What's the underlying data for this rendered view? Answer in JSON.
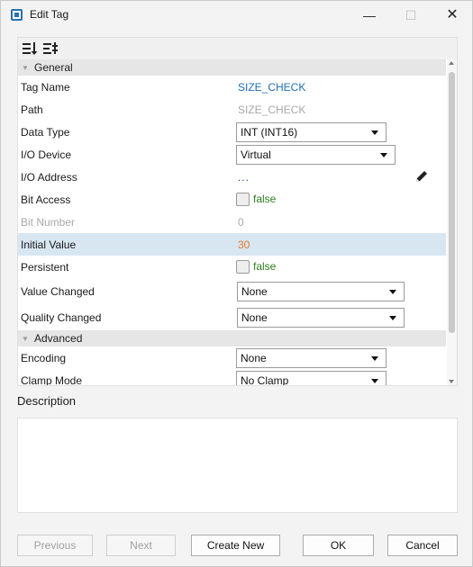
{
  "window": {
    "title": "Edit Tag",
    "controls": {
      "minimize": "—",
      "maximize": "☐",
      "close": "✕"
    },
    "icon": "app-tag-icon"
  },
  "toolbar": {
    "sort_category_icon": "sort-categorized-icon",
    "sort_alpha_icon": "sort-alphabetical-icon"
  },
  "properties": {
    "general": {
      "label": "General",
      "rows": {
        "tag_name": {
          "name": "Tag Name",
          "value": "SIZE_CHECK"
        },
        "path": {
          "name": "Path",
          "value": "SIZE_CHECK"
        },
        "data_type": {
          "name": "Data Type",
          "value": "INT (INT16)"
        },
        "io_device": {
          "name": "I/O Device",
          "value": "Virtual"
        },
        "io_address": {
          "name": "I/O Address",
          "value": "...",
          "icon": "pencil-icon"
        },
        "bit_access": {
          "name": "Bit Access",
          "value": "false",
          "checked": false
        },
        "bit_number": {
          "name": "Bit Number",
          "value": "0"
        },
        "initial_value": {
          "name": "Initial Value",
          "value": "30"
        },
        "persistent": {
          "name": "Persistent",
          "value": "false",
          "checked": false
        },
        "value_changed": {
          "name": "Value Changed",
          "value": "None"
        },
        "quality_changed": {
          "name": "Quality Changed",
          "value": "None"
        }
      }
    },
    "advanced": {
      "label": "Advanced",
      "rows": {
        "encoding": {
          "name": "Encoding",
          "value": "None"
        },
        "clamp_mode": {
          "name": "Clamp Mode",
          "value": "No Clamp"
        }
      }
    }
  },
  "description": {
    "label": "Description",
    "value": ""
  },
  "buttons": {
    "previous": "Previous",
    "next": "Next",
    "create_new": "Create New",
    "ok": "OK",
    "cancel": "Cancel"
  },
  "colors": {
    "tag_name": "#1f6fb0",
    "initial_value": "#e07a2e",
    "bool_false": "#2e7d1e",
    "selected_row": "#d8e6f2"
  }
}
